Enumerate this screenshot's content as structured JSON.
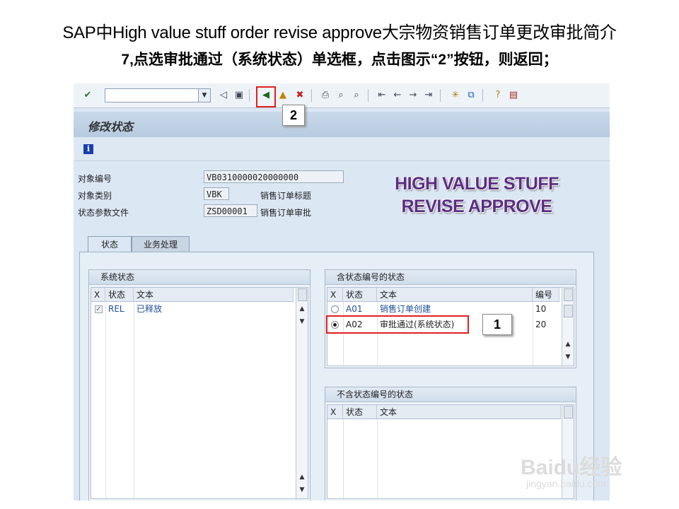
{
  "header": {
    "line1": "SAP中High value stuff order revise approve大宗物资销售订单更改审批简介",
    "line2": "7,点选审批通过（系统状态）单选框，点击图示“2”按钮，则返回；"
  },
  "window": {
    "title": "修改状态",
    "fields": [
      {
        "label": "对象编号",
        "value": "VB0310000020000000",
        "desc": ""
      },
      {
        "label": "对象类别",
        "value": "VBK",
        "desc": "销售订单标题"
      },
      {
        "label": "状态参数文件",
        "value": "ZSD00001",
        "desc": "销售订单审批"
      }
    ],
    "watermark": [
      "HIGH VALUE STUFF",
      "REVISE APPROVE"
    ],
    "tabs": [
      {
        "label": "状态"
      },
      {
        "label": "业务处理"
      }
    ],
    "system_status": {
      "title": "系统状态",
      "columns": [
        "X",
        "状态",
        "文本"
      ],
      "rows": [
        {
          "x": true,
          "status": "REL",
          "text": "已释放"
        }
      ]
    },
    "user_status": {
      "title": "含状态编号的状态",
      "columns": [
        "X",
        "状态",
        "文本",
        "编号"
      ],
      "rows": [
        {
          "selected": false,
          "status": "A01",
          "text": "销售订单创建",
          "number": "10"
        },
        {
          "selected": true,
          "status": "A02",
          "text": "审批通过(系统状态)",
          "number": "20"
        }
      ]
    },
    "user_status_nonum": {
      "title": "不含状态编号的状态",
      "columns": [
        "X",
        "状态",
        "文本"
      ],
      "rows": []
    }
  },
  "callouts": {
    "one": "1",
    "two": "2"
  },
  "toolbar_icons": [
    "enter-icon",
    "back-icon",
    "exit-icon",
    "cancel-icon",
    "print-icon",
    "find-icon",
    "find-next-icon",
    "first-page-icon",
    "prev-page-icon",
    "next-page-icon",
    "last-page-icon",
    "new-session-icon",
    "shortcut-icon",
    "help-icon",
    "layout-icon"
  ],
  "brand": {
    "watermark_logo": "Baidu经验",
    "watermark_url": "jingyan.baidu.com"
  },
  "colors": {
    "highlight": "#e02020",
    "link_text": "#1f4e99",
    "watermark_purple": "#5a2d82"
  }
}
